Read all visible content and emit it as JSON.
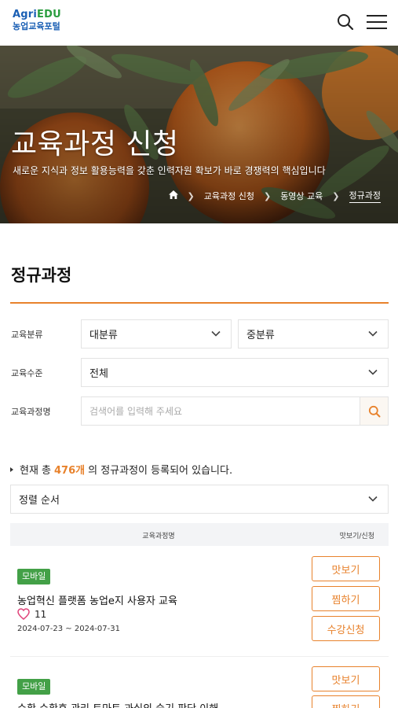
{
  "header": {
    "logo_line1_a": "Agri",
    "logo_line1_b": "EDU",
    "logo_line2": "농업교육포털"
  },
  "hero": {
    "title": "교육과정 신청",
    "subtitle": "새로운 지식과 정보 활용능력을 갖춘 인력자원 확보가 바로 경쟁력의 핵심입니다",
    "breadcrumb": [
      "교육과정 신청",
      "동영상 교육",
      "정규과정"
    ]
  },
  "section": {
    "title": "정규과정"
  },
  "filters": {
    "category_label": "교육분류",
    "major_value": "대분류",
    "minor_value": "중분류",
    "level_label": "교육수준",
    "level_value": "전체",
    "name_label": "교육과정명",
    "search_placeholder": "검색어를 입력해 주세요"
  },
  "count": {
    "prefix": "현재 총",
    "number": "476개",
    "suffix": "의 정규과정이 등록되어 있습니다."
  },
  "sort": {
    "label": "정렬 순서"
  },
  "table": {
    "col_name": "교육과정명",
    "col_action": "맛보기/신청"
  },
  "courses": [
    {
      "badge": "모바일",
      "title": "농업혁신 플랫폼 농업e지 사용자 교육",
      "likes": "11",
      "dates": "2024-07-23 ~ 2024-07-31",
      "btn_preview": "맛보기",
      "btn_wish": "찜하기",
      "btn_apply": "수강신청"
    },
    {
      "badge": "모바일",
      "title": "수확 수확후 관리 토마토 과실의 숙기 판단 이해",
      "btn_preview": "맛보기",
      "btn_wish": "찜하기"
    }
  ],
  "colors": {
    "accent": "#e8822c",
    "badge": "#43a047",
    "brand_blue": "#1a5fb4"
  }
}
